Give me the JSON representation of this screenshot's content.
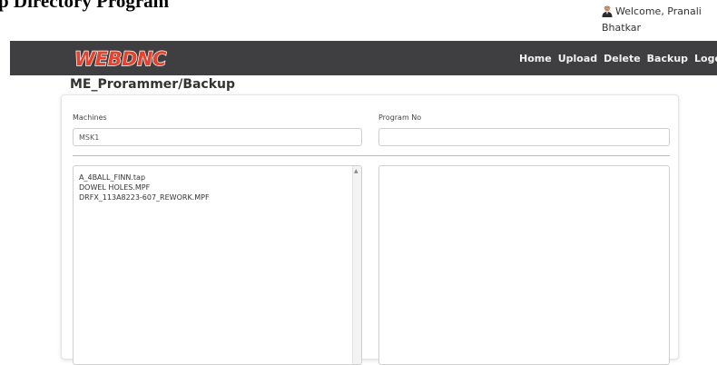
{
  "page": {
    "heading": "p Directory Program"
  },
  "user": {
    "welcome": "Welcome, Pranali Bhatkar",
    "avatar_icon": "user-avatar-icon"
  },
  "navbar": {
    "logo_text": "WEBDNC",
    "links": [
      "Home",
      "Upload",
      "Delete",
      "Backup",
      "Logou"
    ]
  },
  "breadcrumb": "ME_Prorammer/Backup",
  "form": {
    "machines_label": "Machines",
    "machines_value": "MSK1",
    "program_label": "Program No",
    "program_value": ""
  },
  "file_list": [
    "A_4BALL_FINN.tap",
    "DOWEL HOLES.MPF",
    "DRFX_113A8223-607_REWORK.MPF"
  ],
  "colors": {
    "navbar_bg": "#3f3f42",
    "logo_fill": "#e8422c",
    "nav_text": "#f2f2f2"
  }
}
